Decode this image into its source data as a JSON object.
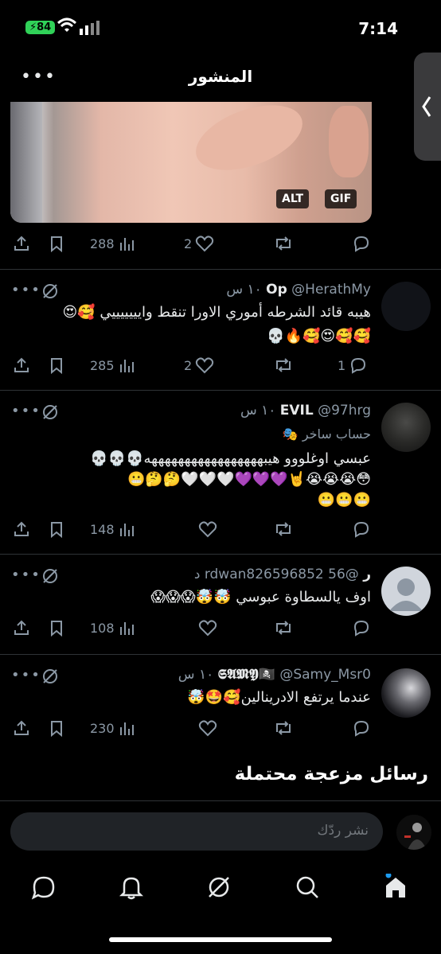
{
  "status_bar": {
    "time": "7:14",
    "battery": "84"
  },
  "header": {
    "title": "المنشور",
    "more": "•••"
  },
  "media": {
    "alt_badge": "ALT",
    "gif_badge": "GIF"
  },
  "post_actions": {
    "views": "288",
    "likes": "2"
  },
  "tweets": [
    {
      "name": "Op",
      "handle": "@HerathMy",
      "time": "١٠ س",
      "text_line1": "هيبه قائد الشرطه أموري الاورا تنقط وايييييييي 🥰😍",
      "text_line2": "🥰🥰😍🥰🔥💀",
      "views": "285",
      "likes": "2",
      "replies": "1"
    },
    {
      "name": "EVIL",
      "handle": "@97hrg",
      "time": "١٠ س",
      "label": "حساب ساخر",
      "text_line1": "عبسي اوغلووو هيبهههههههههههههههههه💀💀💀",
      "text_line2": "😳😭😭😭🤘💜💜💜🤍🤍🤍🤔🤔😬",
      "text_line3": "😬😬😬",
      "views": "148"
    },
    {
      "name": "ر",
      "handle": "@rdwan826596852",
      "time": "56 د",
      "text_line1": "اوف يالسطاوة عبوسي 🤯🤯😱😱😱",
      "views": "108"
    },
    {
      "name": "𝕾𝕬𝕸𝖄🏴‍☠️",
      "handle": "@Samy_Msr0",
      "time": "١٠ س",
      "text_line1": "عندما يرتفع الادرينالين🥰🤩🤯",
      "views": "230"
    }
  ],
  "section_title": "رسائل مزعجة محتملة",
  "reply": {
    "placeholder": "نشر ردّك"
  },
  "nav": {
    "items": [
      "messages",
      "notifications",
      "grok",
      "search",
      "home"
    ]
  },
  "colors": {
    "accent": "#1d9bf0",
    "muted": "#8b98a5",
    "background": "#000000"
  }
}
